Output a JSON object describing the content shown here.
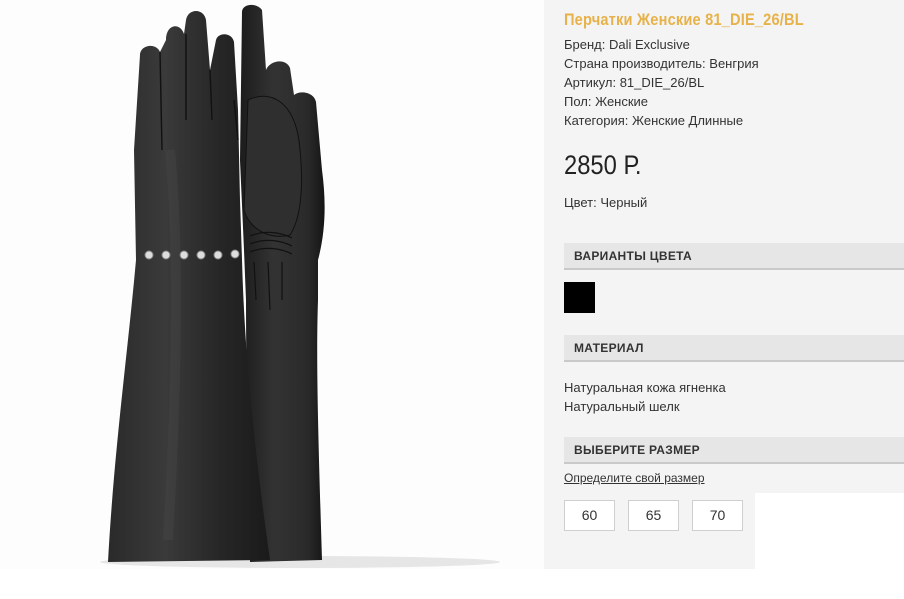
{
  "product": {
    "title": "Перчатки Женские 81_DIE_26/BL",
    "specs": [
      "Бренд: Dali Exclusive",
      "Страна производитель: Венгрия",
      "Артикул: 81_DIE_26/BL",
      "Пол: Женские",
      "Категория: Женские Длинные"
    ],
    "price": "2850 Р.",
    "color_line": "Цвет: Черный"
  },
  "sections": {
    "color_variants": "ВАРИАНТЫ ЦВЕТА",
    "material": "МАТЕРИАЛ",
    "size": "ВЫБЕРИТЕ РАЗМЕР"
  },
  "color_swatches": [
    {
      "name": "black",
      "color": "#000000"
    }
  ],
  "materials": [
    "Натуральная кожа ягненка",
    "Натуральный шелк"
  ],
  "size_link": "Определите свой размер",
  "sizes": [
    "60",
    "65",
    "70"
  ],
  "colors": {
    "title_accent": "#e7b24a",
    "glove": "#1e1e1e"
  }
}
